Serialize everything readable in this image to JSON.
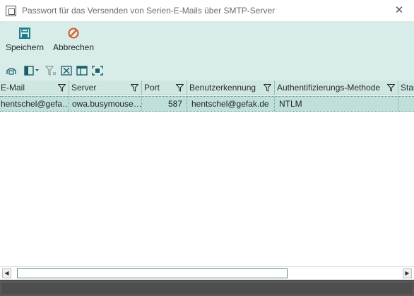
{
  "window": {
    "title": "Passwort für das Versenden von Serien-E-Mails über SMTP-Server",
    "close_glyph": "✕"
  },
  "ribbon": {
    "save_label": "Speichern",
    "cancel_label": "Abbrechen",
    "save_color": "#1a7f8a",
    "cancel_color": "#d9531e"
  },
  "toolbar_icons": [
    "refresh-icon",
    "column-chooser-icon",
    "clear-filter-icon",
    "export-excel-icon",
    "layout-icon",
    "fit-columns-icon"
  ],
  "grid": {
    "columns": [
      "E-Mail",
      "Server",
      "Port",
      "Benutzerkennung",
      "Authentifizierungs-Methode",
      "Star"
    ],
    "rows": [
      [
        "hentschel@gefa…",
        "owa.busymouse…",
        "587",
        "hentschel@gefak.de",
        "NTLM",
        ""
      ]
    ]
  },
  "scrollbar": {
    "left_arrow": "◀",
    "right_arrow": "▶"
  }
}
